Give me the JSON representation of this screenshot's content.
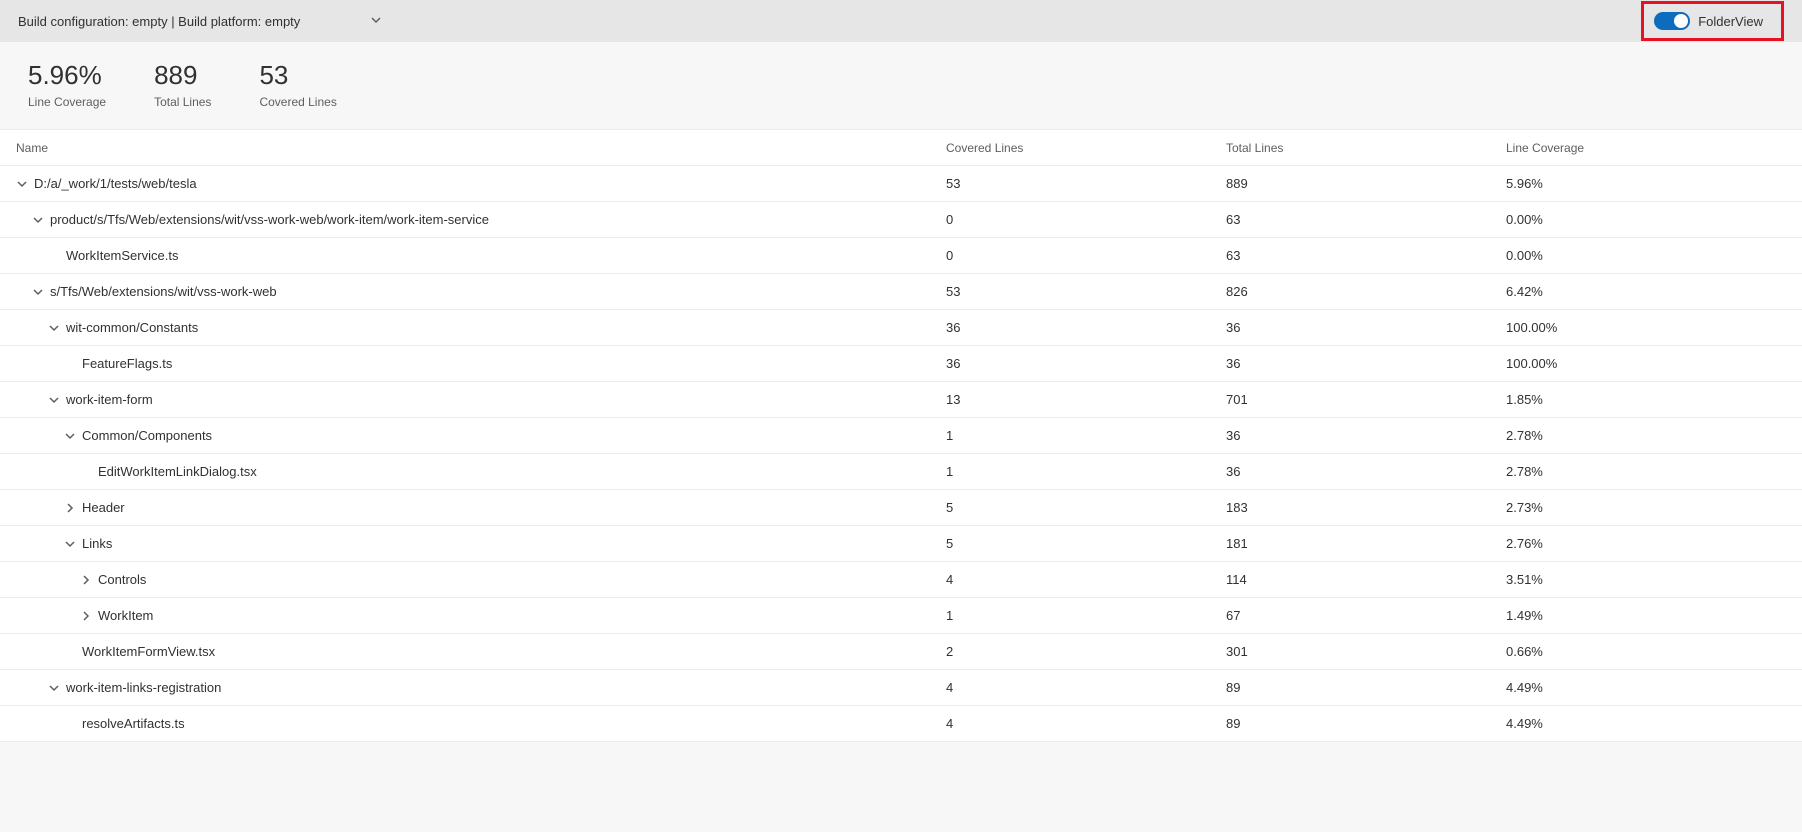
{
  "buildConfig": {
    "text": "Build configuration: empty | Build platform: empty"
  },
  "folderView": {
    "label": "FolderView",
    "enabled": true
  },
  "summary": {
    "lineCoverage": {
      "value": "5.96%",
      "label": "Line Coverage"
    },
    "totalLines": {
      "value": "889",
      "label": "Total Lines"
    },
    "coveredLines": {
      "value": "53",
      "label": "Covered Lines"
    }
  },
  "columns": {
    "name": "Name",
    "covered": "Covered Lines",
    "total": "Total Lines",
    "coverage": "Line Coverage"
  },
  "rows": [
    {
      "indent": 0,
      "chevron": "down",
      "name": "D:/a/_work/1/tests/web/tesla",
      "covered": "53",
      "total": "889",
      "coverage": "5.96%"
    },
    {
      "indent": 1,
      "chevron": "down",
      "name": "product/s/Tfs/Web/extensions/wit/vss-work-web/work-item/work-item-service",
      "covered": "0",
      "total": "63",
      "coverage": "0.00%"
    },
    {
      "indent": 2,
      "chevron": "none",
      "name": "WorkItemService.ts",
      "covered": "0",
      "total": "63",
      "coverage": "0.00%"
    },
    {
      "indent": 1,
      "chevron": "down",
      "name": "s/Tfs/Web/extensions/wit/vss-work-web",
      "covered": "53",
      "total": "826",
      "coverage": "6.42%"
    },
    {
      "indent": 2,
      "chevron": "down",
      "name": "wit-common/Constants",
      "covered": "36",
      "total": "36",
      "coverage": "100.00%"
    },
    {
      "indent": 3,
      "chevron": "none",
      "name": "FeatureFlags.ts",
      "covered": "36",
      "total": "36",
      "coverage": "100.00%"
    },
    {
      "indent": 2,
      "chevron": "down",
      "name": "work-item-form",
      "covered": "13",
      "total": "701",
      "coverage": "1.85%"
    },
    {
      "indent": 3,
      "chevron": "down",
      "name": "Common/Components",
      "covered": "1",
      "total": "36",
      "coverage": "2.78%"
    },
    {
      "indent": 4,
      "chevron": "none",
      "name": "EditWorkItemLinkDialog.tsx",
      "covered": "1",
      "total": "36",
      "coverage": "2.78%"
    },
    {
      "indent": 3,
      "chevron": "right",
      "name": "Header",
      "covered": "5",
      "total": "183",
      "coverage": "2.73%"
    },
    {
      "indent": 3,
      "chevron": "down",
      "name": "Links",
      "covered": "5",
      "total": "181",
      "coverage": "2.76%"
    },
    {
      "indent": 4,
      "chevron": "right",
      "name": "Controls",
      "covered": "4",
      "total": "114",
      "coverage": "3.51%"
    },
    {
      "indent": 4,
      "chevron": "right",
      "name": "WorkItem",
      "covered": "1",
      "total": "67",
      "coverage": "1.49%"
    },
    {
      "indent": 3,
      "chevron": "none",
      "name": "WorkItemFormView.tsx",
      "covered": "2",
      "total": "301",
      "coverage": "0.66%"
    },
    {
      "indent": 2,
      "chevron": "down",
      "name": "work-item-links-registration",
      "covered": "4",
      "total": "89",
      "coverage": "4.49%"
    },
    {
      "indent": 3,
      "chevron": "none",
      "name": "resolveArtifacts.ts",
      "covered": "4",
      "total": "89",
      "coverage": "4.49%"
    }
  ]
}
